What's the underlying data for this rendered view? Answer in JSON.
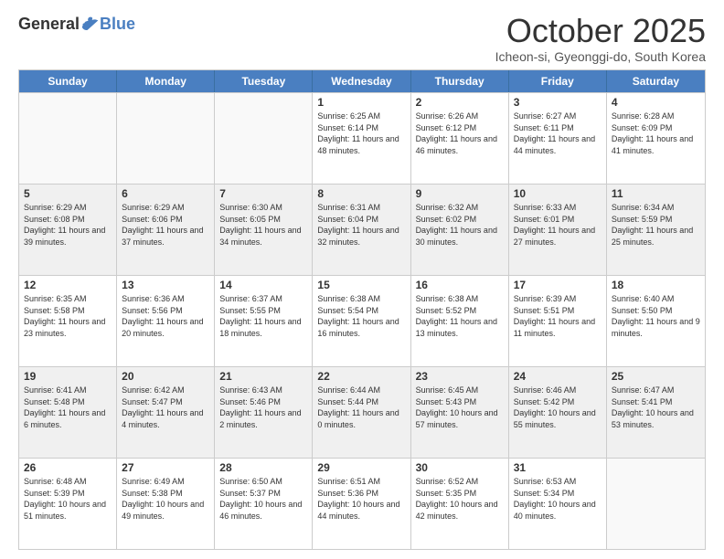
{
  "header": {
    "logo_general": "General",
    "logo_blue": "Blue",
    "month_title": "October 2025",
    "location": "Icheon-si, Gyeonggi-do, South Korea"
  },
  "weekdays": [
    "Sunday",
    "Monday",
    "Tuesday",
    "Wednesday",
    "Thursday",
    "Friday",
    "Saturday"
  ],
  "rows": [
    [
      {
        "day": "",
        "sun": "",
        "set": "",
        "day_text": "",
        "empty": true
      },
      {
        "day": "",
        "sun": "",
        "set": "",
        "day_text": "",
        "empty": true
      },
      {
        "day": "",
        "sun": "",
        "set": "",
        "day_text": "",
        "empty": true
      },
      {
        "day": "1",
        "sun": "Sunrise: 6:25 AM",
        "set": "Sunset: 6:14 PM",
        "day_text": "Daylight: 11 hours and 48 minutes."
      },
      {
        "day": "2",
        "sun": "Sunrise: 6:26 AM",
        "set": "Sunset: 6:12 PM",
        "day_text": "Daylight: 11 hours and 46 minutes."
      },
      {
        "day": "3",
        "sun": "Sunrise: 6:27 AM",
        "set": "Sunset: 6:11 PM",
        "day_text": "Daylight: 11 hours and 44 minutes."
      },
      {
        "day": "4",
        "sun": "Sunrise: 6:28 AM",
        "set": "Sunset: 6:09 PM",
        "day_text": "Daylight: 11 hours and 41 minutes."
      }
    ],
    [
      {
        "day": "5",
        "sun": "Sunrise: 6:29 AM",
        "set": "Sunset: 6:08 PM",
        "day_text": "Daylight: 11 hours and 39 minutes."
      },
      {
        "day": "6",
        "sun": "Sunrise: 6:29 AM",
        "set": "Sunset: 6:06 PM",
        "day_text": "Daylight: 11 hours and 37 minutes."
      },
      {
        "day": "7",
        "sun": "Sunrise: 6:30 AM",
        "set": "Sunset: 6:05 PM",
        "day_text": "Daylight: 11 hours and 34 minutes."
      },
      {
        "day": "8",
        "sun": "Sunrise: 6:31 AM",
        "set": "Sunset: 6:04 PM",
        "day_text": "Daylight: 11 hours and 32 minutes."
      },
      {
        "day": "9",
        "sun": "Sunrise: 6:32 AM",
        "set": "Sunset: 6:02 PM",
        "day_text": "Daylight: 11 hours and 30 minutes."
      },
      {
        "day": "10",
        "sun": "Sunrise: 6:33 AM",
        "set": "Sunset: 6:01 PM",
        "day_text": "Daylight: 11 hours and 27 minutes."
      },
      {
        "day": "11",
        "sun": "Sunrise: 6:34 AM",
        "set": "Sunset: 5:59 PM",
        "day_text": "Daylight: 11 hours and 25 minutes."
      }
    ],
    [
      {
        "day": "12",
        "sun": "Sunrise: 6:35 AM",
        "set": "Sunset: 5:58 PM",
        "day_text": "Daylight: 11 hours and 23 minutes."
      },
      {
        "day": "13",
        "sun": "Sunrise: 6:36 AM",
        "set": "Sunset: 5:56 PM",
        "day_text": "Daylight: 11 hours and 20 minutes."
      },
      {
        "day": "14",
        "sun": "Sunrise: 6:37 AM",
        "set": "Sunset: 5:55 PM",
        "day_text": "Daylight: 11 hours and 18 minutes."
      },
      {
        "day": "15",
        "sun": "Sunrise: 6:38 AM",
        "set": "Sunset: 5:54 PM",
        "day_text": "Daylight: 11 hours and 16 minutes."
      },
      {
        "day": "16",
        "sun": "Sunrise: 6:38 AM",
        "set": "Sunset: 5:52 PM",
        "day_text": "Daylight: 11 hours and 13 minutes."
      },
      {
        "day": "17",
        "sun": "Sunrise: 6:39 AM",
        "set": "Sunset: 5:51 PM",
        "day_text": "Daylight: 11 hours and 11 minutes."
      },
      {
        "day": "18",
        "sun": "Sunrise: 6:40 AM",
        "set": "Sunset: 5:50 PM",
        "day_text": "Daylight: 11 hours and 9 minutes."
      }
    ],
    [
      {
        "day": "19",
        "sun": "Sunrise: 6:41 AM",
        "set": "Sunset: 5:48 PM",
        "day_text": "Daylight: 11 hours and 6 minutes."
      },
      {
        "day": "20",
        "sun": "Sunrise: 6:42 AM",
        "set": "Sunset: 5:47 PM",
        "day_text": "Daylight: 11 hours and 4 minutes."
      },
      {
        "day": "21",
        "sun": "Sunrise: 6:43 AM",
        "set": "Sunset: 5:46 PM",
        "day_text": "Daylight: 11 hours and 2 minutes."
      },
      {
        "day": "22",
        "sun": "Sunrise: 6:44 AM",
        "set": "Sunset: 5:44 PM",
        "day_text": "Daylight: 11 hours and 0 minutes."
      },
      {
        "day": "23",
        "sun": "Sunrise: 6:45 AM",
        "set": "Sunset: 5:43 PM",
        "day_text": "Daylight: 10 hours and 57 minutes."
      },
      {
        "day": "24",
        "sun": "Sunrise: 6:46 AM",
        "set": "Sunset: 5:42 PM",
        "day_text": "Daylight: 10 hours and 55 minutes."
      },
      {
        "day": "25",
        "sun": "Sunrise: 6:47 AM",
        "set": "Sunset: 5:41 PM",
        "day_text": "Daylight: 10 hours and 53 minutes."
      }
    ],
    [
      {
        "day": "26",
        "sun": "Sunrise: 6:48 AM",
        "set": "Sunset: 5:39 PM",
        "day_text": "Daylight: 10 hours and 51 minutes."
      },
      {
        "day": "27",
        "sun": "Sunrise: 6:49 AM",
        "set": "Sunset: 5:38 PM",
        "day_text": "Daylight: 10 hours and 49 minutes."
      },
      {
        "day": "28",
        "sun": "Sunrise: 6:50 AM",
        "set": "Sunset: 5:37 PM",
        "day_text": "Daylight: 10 hours and 46 minutes."
      },
      {
        "day": "29",
        "sun": "Sunrise: 6:51 AM",
        "set": "Sunset: 5:36 PM",
        "day_text": "Daylight: 10 hours and 44 minutes."
      },
      {
        "day": "30",
        "sun": "Sunrise: 6:52 AM",
        "set": "Sunset: 5:35 PM",
        "day_text": "Daylight: 10 hours and 42 minutes."
      },
      {
        "day": "31",
        "sun": "Sunrise: 6:53 AM",
        "set": "Sunset: 5:34 PM",
        "day_text": "Daylight: 10 hours and 40 minutes."
      },
      {
        "day": "",
        "sun": "",
        "set": "",
        "day_text": "",
        "empty": true
      }
    ]
  ]
}
